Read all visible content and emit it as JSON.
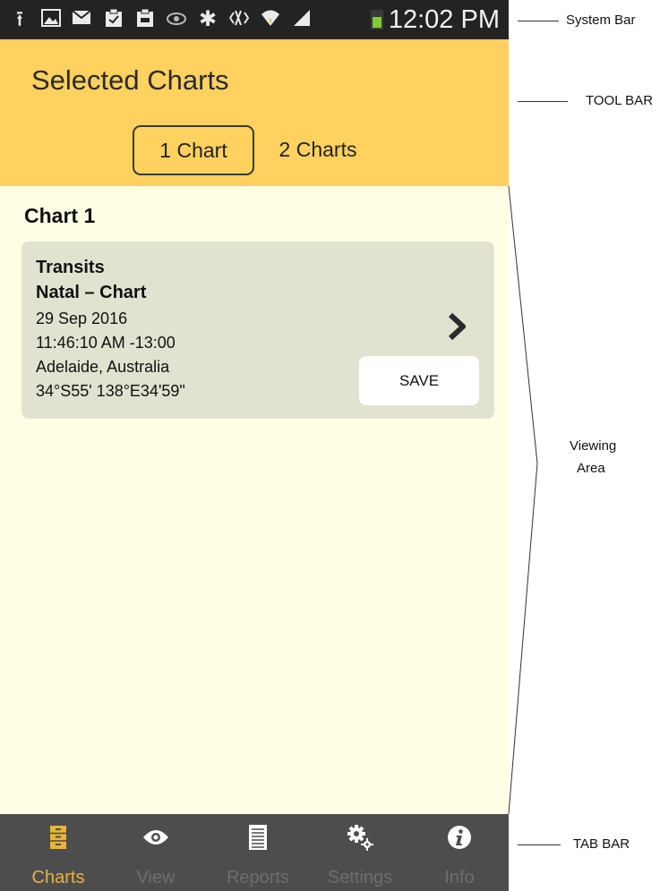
{
  "status_bar": {
    "time": "12:02 PM",
    "icons": [
      "upload-icon",
      "image-icon",
      "email-icon",
      "clipboard-check-icon",
      "clipboard-icon",
      "eye-icon",
      "bluetooth-icon",
      "signal-mute-icon",
      "wifi-icon",
      "cell-signal-icon",
      "battery-charging-icon"
    ]
  },
  "toolbar": {
    "title": "Selected Charts",
    "segments": [
      {
        "label": "1 Chart",
        "selected": true
      },
      {
        "label": "2 Charts",
        "selected": false
      }
    ]
  },
  "main": {
    "section_title": "Chart 1",
    "card": {
      "line1": "Transits",
      "line2": "Natal – Chart",
      "date": "29 Sep 2016",
      "time": "11:46:10 AM  -13:00",
      "place": "Adelaide, Australia",
      "coords": "34°S55'  138°E34'59\"",
      "save_label": "SAVE"
    }
  },
  "tab_bar": {
    "tabs": [
      {
        "label": "Charts",
        "icon": "cabinet-icon",
        "active": true
      },
      {
        "label": "View",
        "icon": "eye-icon",
        "active": false
      },
      {
        "label": "Reports",
        "icon": "document-icon",
        "active": false
      },
      {
        "label": "Settings",
        "icon": "gears-icon",
        "active": false
      },
      {
        "label": "Info",
        "icon": "info-icon",
        "active": false
      }
    ]
  },
  "annotations": {
    "system_bar": "System Bar",
    "tool_bar": "TOOL BAR",
    "viewing_area_1": "Viewing",
    "viewing_area_2": "Area",
    "tab_bar": "TAB BAR"
  },
  "colors": {
    "toolbar": "#ffd15f",
    "viewing_area": "#ffffe6",
    "card": "#e2e2d0",
    "tab_bar": "#4d4d4d",
    "active_tab": "#e9b43a"
  }
}
